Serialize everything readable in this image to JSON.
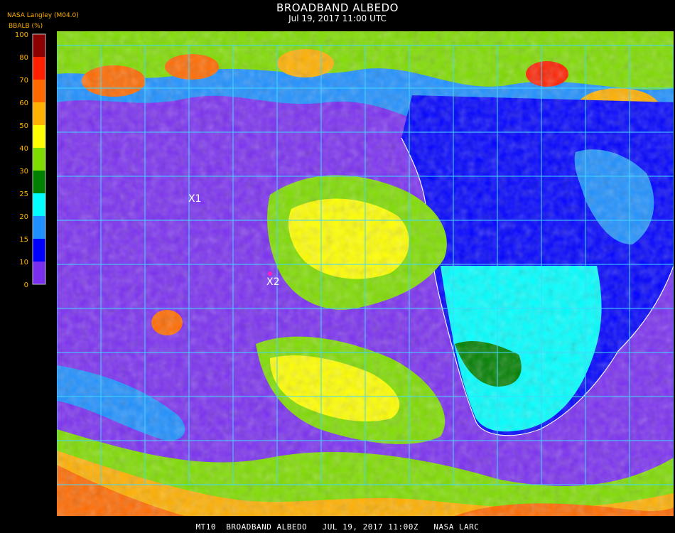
{
  "header": {
    "title": "BROADBAND ALBEDO",
    "subtitle": "Jul 19, 2017 11:00 UTC",
    "producer": "NASA Langley (M04.0)",
    "unit_label": "BBALB (%)"
  },
  "legend": {
    "ticks": [
      "100",
      "80",
      "70",
      "60",
      "50",
      "40",
      "30",
      "25",
      "20",
      "15",
      "10",
      "0"
    ],
    "colors": [
      "#8b0000",
      "#ff2000",
      "#ff6a00",
      "#ffb000",
      "#ffff00",
      "#7fdc00",
      "#008000",
      "#00ffff",
      "#1e90ff",
      "#0000ff",
      "#7a2ff0"
    ],
    "tick_color": "#ffb000"
  },
  "map": {
    "markers": [
      {
        "label": "X1"
      },
      {
        "label": "X2"
      }
    ],
    "grid_color": "#40d8ff",
    "coast_color": "#ffffff",
    "grid_label_color": "#ff2060"
  },
  "footer": {
    "text": "MT10  BROADBAND ALBEDO   JUL 19, 2017 11:00Z   NASA LARC"
  }
}
